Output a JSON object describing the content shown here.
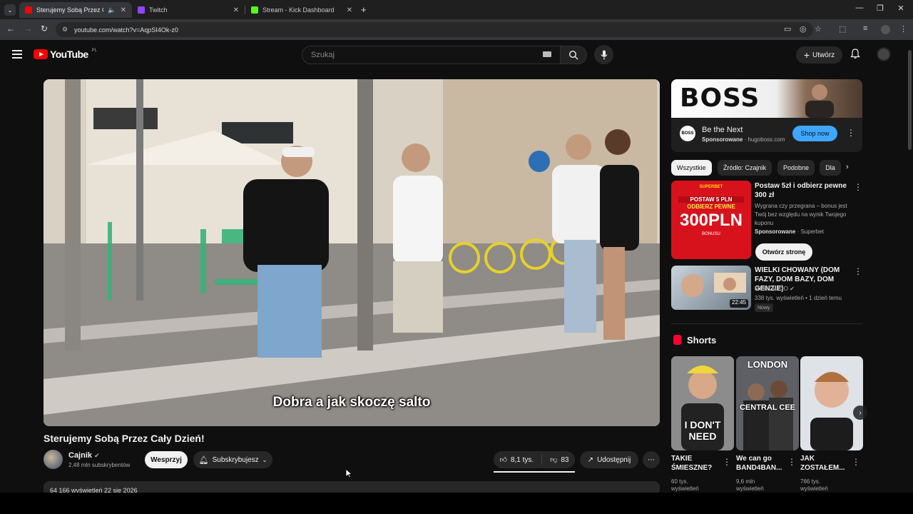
{
  "browser": {
    "tabs": [
      {
        "title": "Sterujemy Sobą Przez Cały D",
        "active": true
      },
      {
        "title": "Twitch",
        "active": false
      },
      {
        "title": "Stream - Kick Dashboard",
        "active": false
      }
    ],
    "url": "youtube.com/watch?v=AqpSI4Ok-z0"
  },
  "header": {
    "logo_text": "YouTube",
    "country_code": "PL",
    "search_placeholder": "Szukaj",
    "create_label": "Utwórz"
  },
  "video": {
    "caption": "Dobra a jak skoczę salto",
    "title": "Sterujemy Sobą Przez Cały Dzień!",
    "channel_name": "Cajnik",
    "subscribers": "2,48 mln subskrybentów",
    "support_label": "Wesprzyj",
    "subscribed_label": "Subskrybujesz",
    "likes": "8,1 tys.",
    "dislikes": "83",
    "share_label": "Udostępnij",
    "description_stats": "64 166 wyświetleń  22 sie 2026"
  },
  "ad": {
    "banner_text": "BOSS",
    "logo_text": "BOSS",
    "title": "Be the Next",
    "sponsored": "Sponsorowane",
    "domain": "hugoboss.com",
    "cta": "Shop now"
  },
  "chips": [
    "Wszystkie",
    "Źródło: Czajnik",
    "Podobne",
    "Dla"
  ],
  "recommendations": [
    {
      "title": "Postaw 5zł i odbierz pewne 300 zł",
      "description": "Wygrana czy przegrana – bonus jest Twój bez względu na wynik Twojego kuponu",
      "sponsored": "Sponsorowane",
      "advertiser": "Superbet",
      "cta": "Otwórz stronę",
      "thumb_lines": [
        "SUPERBET",
        "POSTAW 5 PLN",
        "ODBIERZ PEWNE",
        "300PLN",
        "BONUSU"
      ]
    },
    {
      "title": "WIELKI CHOWANY (DOM FAZY, DOM BAZY, DOM GENZIE)",
      "channel": "MORTALCIO",
      "stats": "338 tys. wyświetleń • 1 dzień temu",
      "badge": "Nowy",
      "duration": "22:45"
    }
  ],
  "shorts": {
    "section_title": "Shorts",
    "items": [
      {
        "title": "TAKIE ŚMIESZNE?",
        "views": "60 tys.",
        "views_label": "wyświetleń",
        "overlay": "I DON'T NEED"
      },
      {
        "title": "We can go BAND4BAN...",
        "views": "9,6 mln",
        "views_label": "wyświetleń",
        "overlay": "CENTRAL CEE"
      },
      {
        "title": "JAK ZOSTAŁEM...",
        "views": "766 tys.",
        "views_label": "wyświetleń",
        "overlay": ""
      }
    ],
    "top_text": "LONDON"
  },
  "colors": {
    "accent": "#ff0000",
    "shop_button": "#3ea6ff",
    "background": "#0f0f0f"
  }
}
